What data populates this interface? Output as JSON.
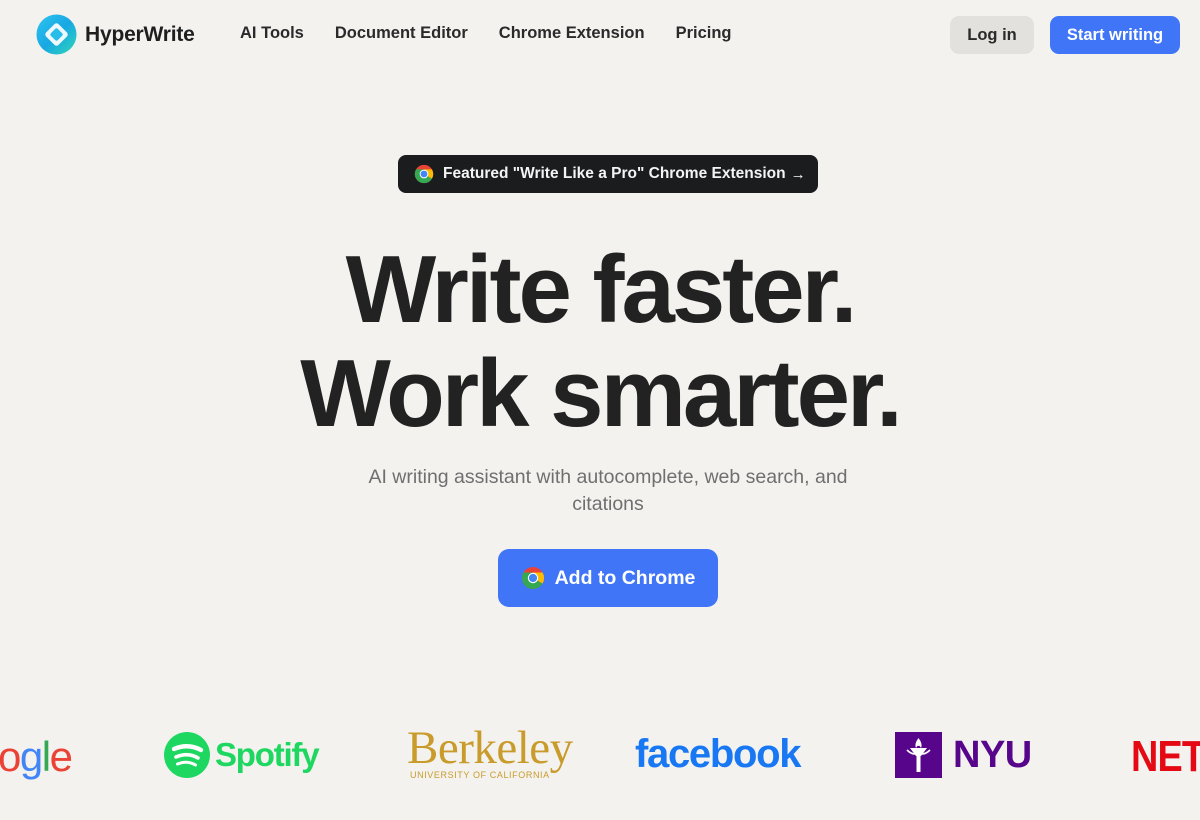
{
  "brand": {
    "name": "HyperWrite",
    "logo_icon": "hyperwrite-logo-icon"
  },
  "nav": {
    "links": [
      "AI Tools",
      "Document Editor",
      "Chrome Extension",
      "Pricing"
    ],
    "login_label": "Log in",
    "start_label": "Start writing"
  },
  "hero": {
    "featured_pill": {
      "text": "Featured \"Write Like a Pro\" Chrome Extension",
      "arrow": "→",
      "icon": "chrome-icon"
    },
    "headline": [
      "Write faster.",
      "Work smarter."
    ],
    "subheadline": "AI writing assistant with autocomplete, web search, and citations",
    "cta_label": "Add to Chrome"
  },
  "logos": {
    "google": [
      "o",
      "g",
      "l",
      "e"
    ],
    "spotify": "Spotify",
    "berkeley": "Berkeley",
    "berkeley_sub": "UNIVERSITY OF CALIFORNIA",
    "facebook": "facebook",
    "nyu": "NYU",
    "netflix": "NET"
  },
  "colors": {
    "background": "#f3f2ef",
    "accent_blue": "#3f75f6",
    "pill_dark": "#1b1c1e",
    "headline": "#222222",
    "subtext": "#6f6f6f",
    "spotify_green": "#1ed760",
    "berkeley_gold": "#c99b2b",
    "facebook_blue": "#1877f2",
    "nyu_purple": "#57068c",
    "netflix_red": "#e50914"
  }
}
